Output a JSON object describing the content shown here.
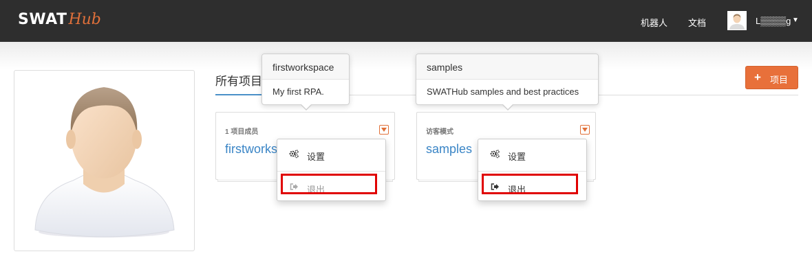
{
  "app": {
    "logo_primary": "SWAT",
    "logo_secondary": "Hub",
    "accent_color": "#e8703a",
    "link_color": "#3a85c6"
  },
  "navbar": {
    "links": [
      {
        "label": "机器人"
      },
      {
        "label": "文档"
      }
    ],
    "user": {
      "name": "L▒▒▒▒g",
      "caret_icon": "caret-down-icon",
      "avatar_icon": "user-avatar-icon"
    }
  },
  "profile": {
    "avatar_icon": "default-user-avatar-icon"
  },
  "projects_section": {
    "title": "所有项目",
    "add_button_label": "项目",
    "add_icon": "plus-icon"
  },
  "cards": [
    {
      "meta": "1 项目成员",
      "name": "firstworkspace",
      "popover_title": "firstworkspace",
      "popover_body": "My first RPA.",
      "menu": [
        {
          "label": "设置",
          "icon": "cogs-icon",
          "disabled": false
        },
        {
          "label": "退出",
          "icon": "sign-out-icon",
          "disabled": true
        }
      ]
    },
    {
      "meta": "访客模式",
      "name": "samples",
      "popover_title": "samples",
      "popover_body": "SWATHub samples and best practices",
      "menu": [
        {
          "label": "设置",
          "icon": "cogs-icon",
          "disabled": false
        },
        {
          "label": "退出",
          "icon": "sign-out-icon",
          "disabled": false
        }
      ]
    }
  ]
}
